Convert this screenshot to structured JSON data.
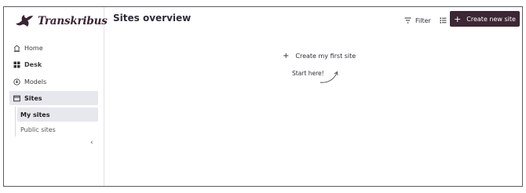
{
  "brand": {
    "name": "Transkribus"
  },
  "sidebar": {
    "items": [
      {
        "label": "Home",
        "icon": "home-icon"
      },
      {
        "label": "Desk",
        "icon": "desk-icon"
      },
      {
        "label": "Models",
        "icon": "models-icon"
      },
      {
        "label": "Sites",
        "icon": "sites-icon",
        "active": true
      }
    ],
    "subitems": [
      {
        "label": "My sites",
        "active": true
      },
      {
        "label": "Public sites"
      }
    ],
    "collapse_glyph": "‹"
  },
  "header": {
    "title": "Sites overview",
    "filter_label": "Filter",
    "create_label": "Create new site",
    "create_glyph": "+"
  },
  "empty_state": {
    "plus_glyph": "+",
    "link_label": "Create my first site",
    "hint": "Start here!"
  },
  "colors": {
    "primary": "#3d2635",
    "active_bg": "#e7e7ee",
    "border": "#5a5a6e"
  }
}
